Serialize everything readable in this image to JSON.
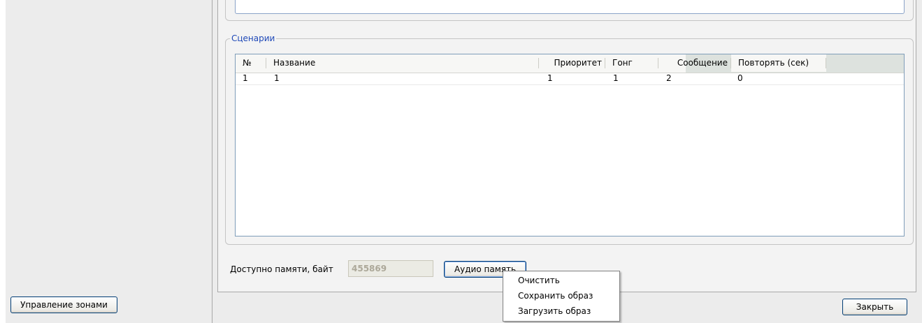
{
  "scenarios": {
    "group_title": "Сценарии",
    "columns": [
      "№",
      "Название",
      "Приоритет",
      "Гонг",
      "Сообщение",
      "Повторять (сек)"
    ],
    "rows": [
      {
        "num": "1",
        "name": "1",
        "priority": "1",
        "gong": "1",
        "message": "2",
        "repeat": "0"
      }
    ]
  },
  "memory": {
    "label": "Доступно памяти, байт",
    "value": "455869"
  },
  "buttons": {
    "audio": "Аудио память",
    "zones": "Управление зонами",
    "close": "Закрыть"
  },
  "context_menu": {
    "items": [
      "Очистить",
      "Сохранить образ",
      "Загрузить образ"
    ]
  },
  "colors": {
    "group_title": "#1f49b8",
    "panel": "#f3f3f3",
    "button_border": "#003c74"
  }
}
